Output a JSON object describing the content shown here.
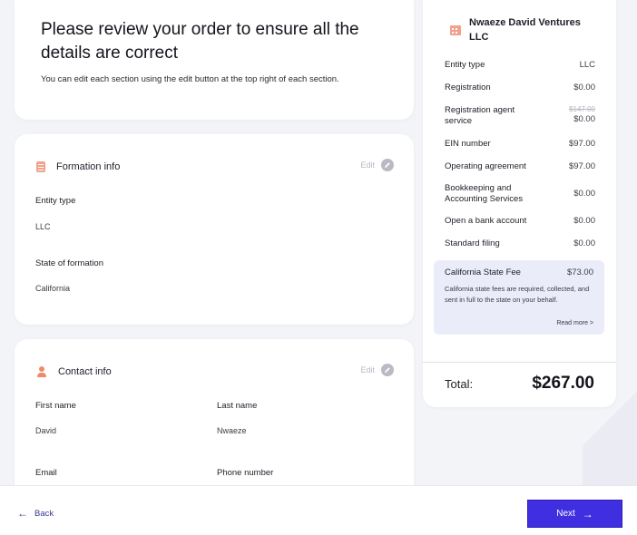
{
  "intro": {
    "title": "Please review your order to ensure all the details are correct",
    "subtitle": "You can edit each section using the edit button at the top right of each section."
  },
  "formation": {
    "title": "Formation info",
    "edit_label": "Edit",
    "fields": [
      {
        "label": "Entity type",
        "value": "LLC"
      },
      {
        "label": "State of formation",
        "value": "California"
      }
    ]
  },
  "contact": {
    "title": "Contact info",
    "edit_label": "Edit",
    "fields": [
      {
        "label": "First name",
        "value": "David"
      },
      {
        "label": "Last name",
        "value": "Nwaeze"
      },
      {
        "label": "Email",
        "value": ""
      },
      {
        "label": "Phone number",
        "value": ""
      }
    ]
  },
  "summary": {
    "company": "Nwaeze David Ventures LLC",
    "rows": [
      {
        "label": "Entity type",
        "price": "LLC"
      },
      {
        "label": "Registration",
        "price": "$0.00"
      },
      {
        "label": "Registration agent service",
        "original": "$147.00",
        "price": "$0.00"
      },
      {
        "label": "EIN number",
        "price": "$97.00"
      },
      {
        "label": "Operating agreement",
        "price": "$97.00"
      },
      {
        "label": "Bookkeeping and Accounting Services",
        "price": "$0.00"
      },
      {
        "label": "Open a bank account",
        "price": "$0.00"
      },
      {
        "label": "Standard filing",
        "price": "$0.00"
      }
    ],
    "state_fee": {
      "title": "California State Fee",
      "price": "$73.00",
      "description": "California state fees are required, collected, and sent in full to the state on your behalf.",
      "read_more": "Read more >"
    },
    "total_label": "Total:",
    "total_value": "$267.00"
  },
  "footer": {
    "back_label": "Back",
    "next_label": "Next"
  },
  "colors": {
    "accent": "#3f2fe0",
    "icon": "#ef8a68",
    "highlight": "#ebecfa"
  }
}
